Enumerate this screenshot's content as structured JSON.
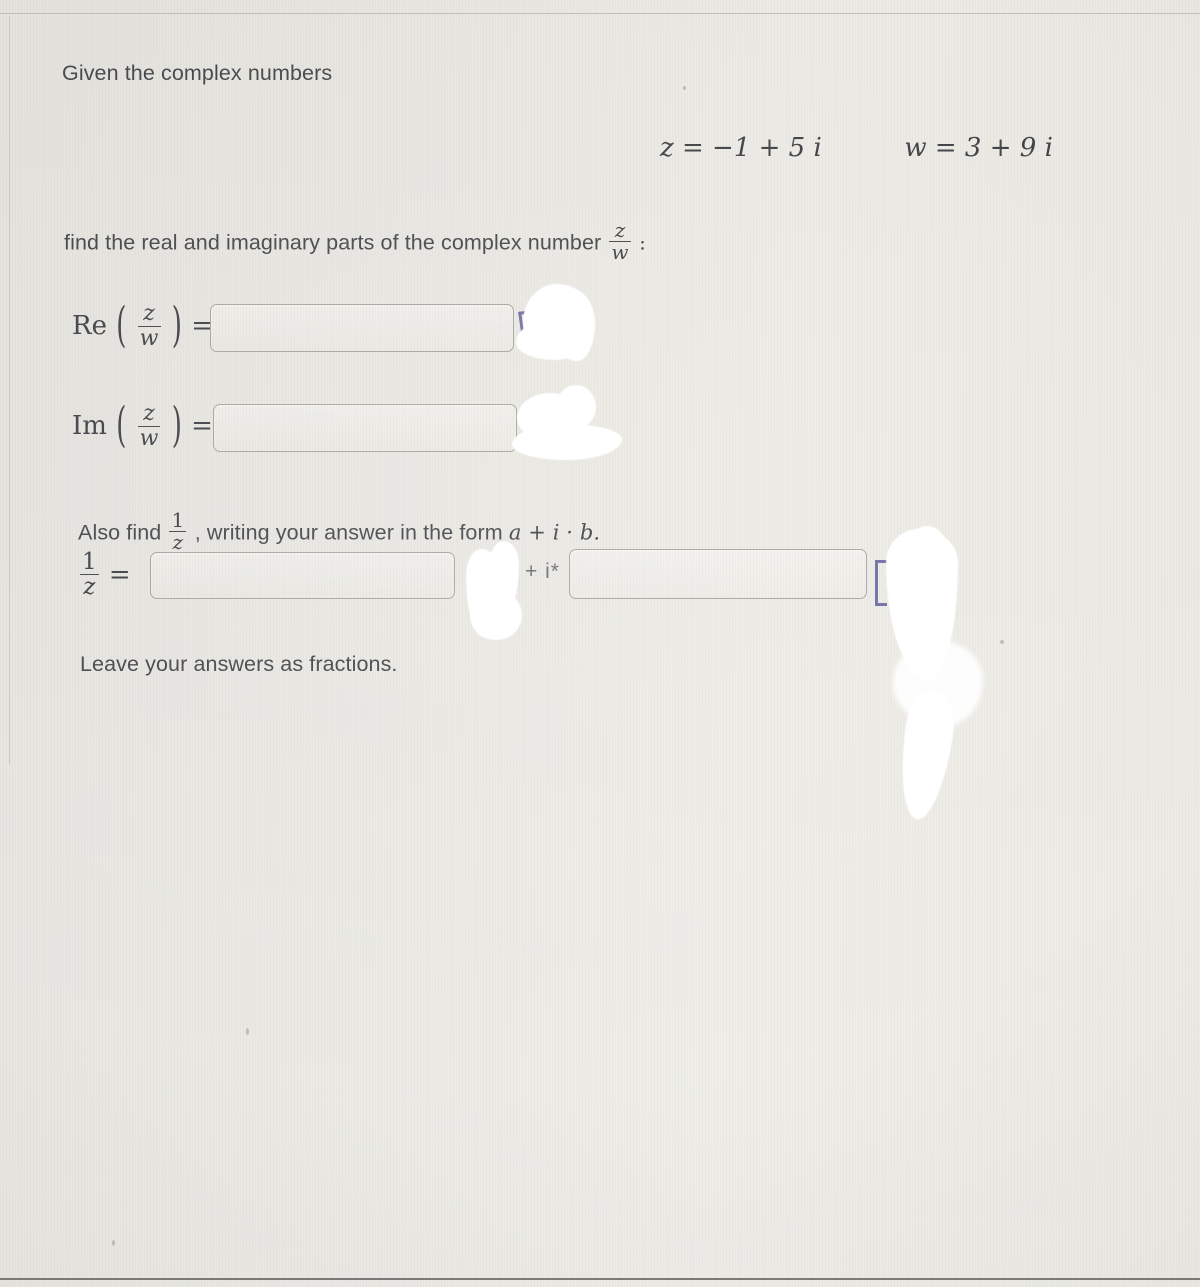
{
  "document": {
    "intro_line": "Given the complex numbers",
    "given": {
      "z_label": "z",
      "z_equals": "=",
      "z_value": "−1 + 5 i",
      "w_label": "w",
      "w_equals": "=",
      "w_value": "3 + 9 i"
    },
    "instruction_line": "find the real and imaginary parts of the complex number",
    "instruction_fraction": {
      "numerator": "z",
      "denominator": "w"
    },
    "instruction_trailing": ":",
    "also_find_prefix": "Also find",
    "also_find_fraction": {
      "numerator": "1",
      "denominator": "z"
    },
    "also_find_suffix": ", writing your answer in the form",
    "also_find_form": "a + i · b.",
    "closing_line": "Leave your answers as fractions."
  },
  "answers": {
    "real_part": {
      "label_prefix": "Re",
      "fraction": {
        "numerator": "z",
        "denominator": "w"
      },
      "equals": "=",
      "value": "",
      "placeholder": ""
    },
    "imaginary_part": {
      "label_prefix": "Im",
      "fraction": {
        "numerator": "z",
        "denominator": "w"
      },
      "equals": "=",
      "value": "",
      "placeholder": ""
    },
    "reciprocal": {
      "fraction": {
        "numerator": "1",
        "denominator": "z"
      },
      "equals": "=",
      "real_value": "",
      "real_placeholder": "",
      "separator": "+ i*",
      "imag_value": "",
      "imag_placeholder": ""
    }
  },
  "symbols": {
    "open_paren": "(",
    "close_paren": ")",
    "equals": "=",
    "colon": ":",
    "plus": "+",
    "dot": "·"
  },
  "colors": {
    "background": "#e8e6e0",
    "body_text": "#45464a",
    "math_text": "#3f4045",
    "input_border": "#a8a59d",
    "caret_accent": "#5b5a9a",
    "glare": "#ffffff",
    "edge_rule": "#b9b7b1"
  }
}
